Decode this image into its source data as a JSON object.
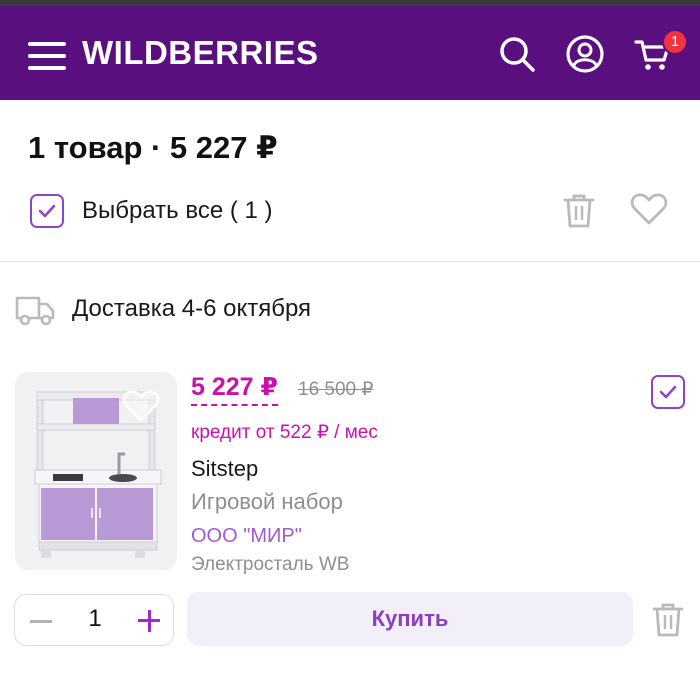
{
  "header": {
    "logo": "WILDBERRIES",
    "cart_badge": "1",
    "icons": [
      "menu-icon",
      "search-icon",
      "profile-icon",
      "cart-icon"
    ],
    "bg_color": "#5a0f7f"
  },
  "cart": {
    "summary": "1 товар · 5 227 ₽",
    "select_all_label": "Выбрать все ( 1 )",
    "select_all_checked": true
  },
  "delivery": {
    "label": "Доставка 4-6 октября"
  },
  "item": {
    "price": "5 227 ₽",
    "old_price": "16 500 ₽",
    "credit": "кредит от 522 ₽ / мес",
    "brand": "Sitstep",
    "name": "Игровой набор",
    "seller": "ООО \"МИР\"",
    "warehouse": "Электросталь WB",
    "checked": true,
    "quantity": "1",
    "buy_label": "Купить",
    "accent_color": "#cb11ab"
  }
}
